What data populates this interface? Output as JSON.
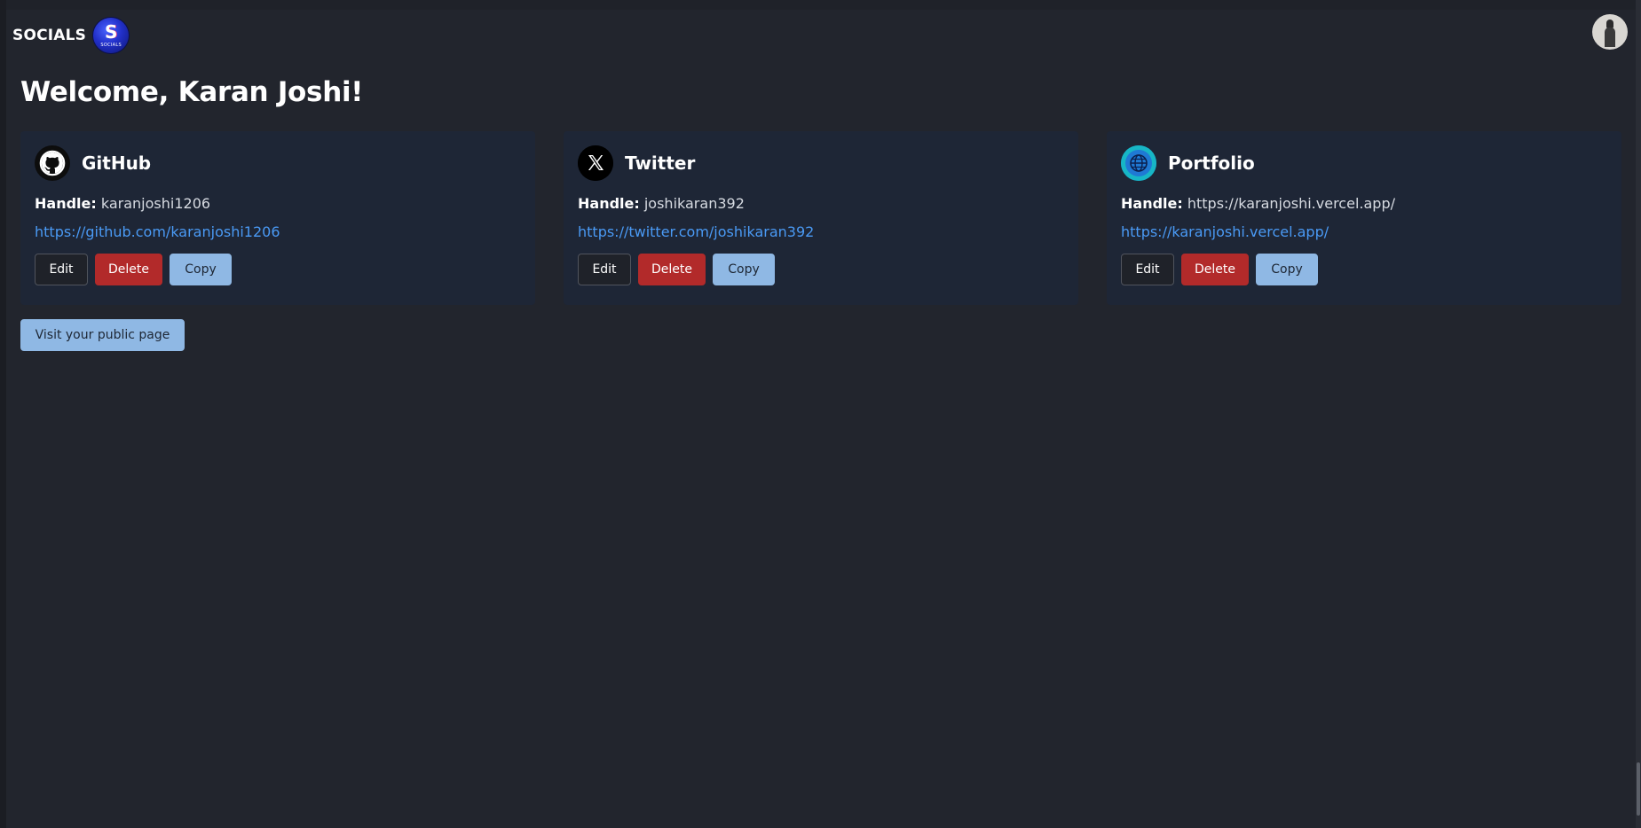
{
  "navbar": {
    "brand": "SOCIALS",
    "logo_letter": "S",
    "logo_subtext": "SOCIALS"
  },
  "welcome": "Welcome, Karan Joshi!",
  "labels": {
    "handle": "Handle:",
    "edit": "Edit",
    "delete": "Delete",
    "copy": "Copy"
  },
  "cards": [
    {
      "icon": "github-icon",
      "title": "GitHub",
      "handle": "karanjoshi1206",
      "url": "https://github.com/karanjoshi1206"
    },
    {
      "icon": "x-twitter-icon",
      "title": "Twitter",
      "handle": "joshikaran392",
      "url": "https://twitter.com/joshikaran392"
    },
    {
      "icon": "globe-icon",
      "title": "Portfolio",
      "handle": "https://karanjoshi.vercel.app/",
      "url": "https://karanjoshi.vercel.app/"
    }
  ],
  "public_page_button": "Visit your public page",
  "colors": {
    "background": "#22252d",
    "card": "#1e2636",
    "link": "#4a9af5",
    "delete": "#b22a2a",
    "copy": "#8fb8e4"
  }
}
